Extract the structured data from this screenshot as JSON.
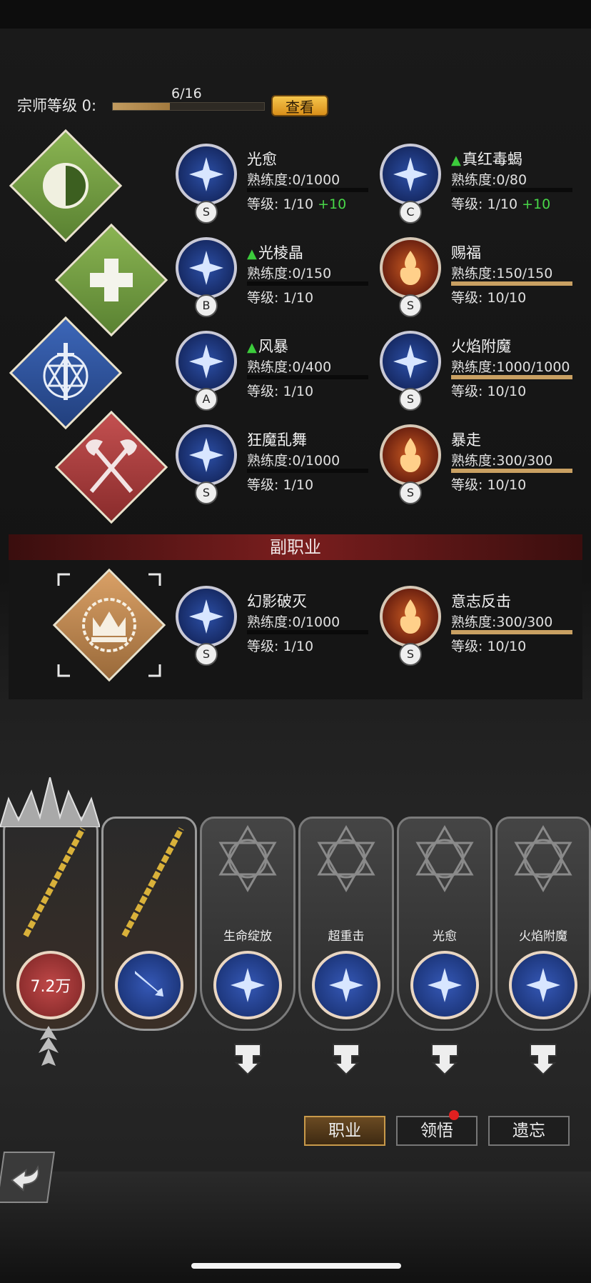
{
  "grandmaster": {
    "label": "宗师等级 0:",
    "progress_text": "6/16",
    "progress_fraction": 0.375,
    "view_button": "查看"
  },
  "class_icons": [
    {
      "name": "yin-yang-diamond-icon",
      "color": "green"
    },
    {
      "name": "healing-cross-diamond-icon",
      "color": "green"
    },
    {
      "name": "holy-sword-diamond-icon",
      "color": "blue"
    },
    {
      "name": "crossed-axes-diamond-icon",
      "color": "red"
    }
  ],
  "skills": [
    {
      "name": "光愈",
      "upgradeable": false,
      "grade": "S",
      "proficiency": "熟练度:0/1000",
      "fill": 0,
      "level": "等级: 1/10",
      "bonus": "+10",
      "type": "holy"
    },
    {
      "name": "真红毒蝎",
      "upgradeable": true,
      "grade": "C",
      "proficiency": "熟练度:0/80",
      "fill": 0,
      "level": "等级: 1/10",
      "bonus": "+10",
      "type": "holy"
    },
    {
      "name": "光棱晶",
      "upgradeable": true,
      "grade": "B",
      "proficiency": "熟练度:0/150",
      "fill": 0,
      "level": "等级: 1/10",
      "bonus": "",
      "type": "holy"
    },
    {
      "name": "赐福",
      "upgradeable": false,
      "grade": "S",
      "proficiency": "熟练度:150/150",
      "fill": 1,
      "level": "等级: 10/10",
      "bonus": "",
      "type": "fire"
    },
    {
      "name": "风暴",
      "upgradeable": true,
      "grade": "A",
      "proficiency": "熟练度:0/400",
      "fill": 0,
      "level": "等级: 1/10",
      "bonus": "",
      "type": "holy"
    },
    {
      "name": "火焰附魔",
      "upgradeable": false,
      "grade": "S",
      "proficiency": "熟练度:1000/1000",
      "fill": 1,
      "level": "等级: 10/10",
      "bonus": "",
      "type": "holy"
    },
    {
      "name": "狂魔乱舞",
      "upgradeable": false,
      "grade": "S",
      "proficiency": "熟练度:0/1000",
      "fill": 0,
      "level": "等级: 1/10",
      "bonus": "",
      "type": "holy"
    },
    {
      "name": "暴走",
      "upgradeable": false,
      "grade": "S",
      "proficiency": "熟练度:300/300",
      "fill": 1,
      "level": "等级: 10/10",
      "bonus": "",
      "type": "fire"
    }
  ],
  "sub_class": {
    "header": "副职业",
    "skills": [
      {
        "name": "幻影破灭",
        "grade": "S",
        "proficiency": "熟练度:0/1000",
        "fill": 0,
        "level": "等级: 1/10",
        "type": "holy"
      },
      {
        "name": "意志反击",
        "grade": "S",
        "proficiency": "熟练度:300/300",
        "fill": 1,
        "level": "等级: 10/10",
        "type": "fire"
      }
    ]
  },
  "slots": [
    {
      "kind": "weapon",
      "orb_text": "7.2万",
      "label": ""
    },
    {
      "kind": "weapon",
      "orb_text": "",
      "label": ""
    },
    {
      "kind": "skill",
      "orb_text": "",
      "label": "生命绽放"
    },
    {
      "kind": "skill",
      "orb_text": "",
      "label": "超重击"
    },
    {
      "kind": "skill",
      "orb_text": "",
      "label": "光愈"
    },
    {
      "kind": "skill",
      "orb_text": "",
      "label": "火焰附魔"
    }
  ],
  "tabs": {
    "profession": "职业",
    "comprehend": "领悟",
    "forget": "遗忘"
  }
}
